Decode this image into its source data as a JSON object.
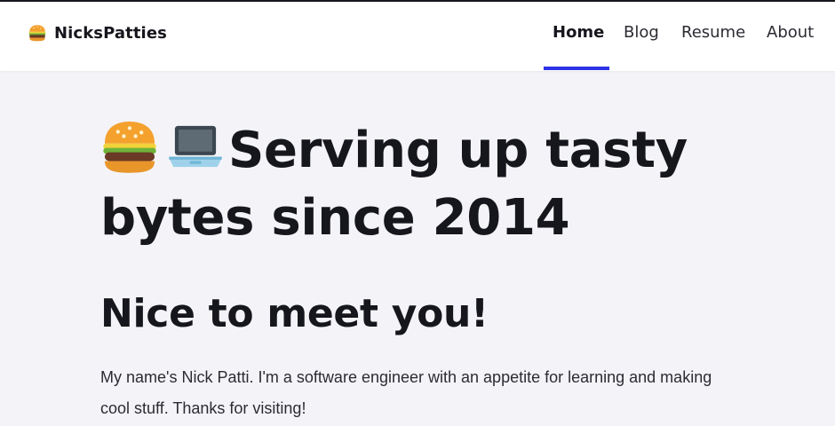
{
  "brand": {
    "name": "NicksPatties",
    "icon": "burger-icon"
  },
  "nav": {
    "items": [
      {
        "label": "Home",
        "active": true
      },
      {
        "label": "Blog",
        "active": false
      },
      {
        "label": "Resume",
        "active": false
      },
      {
        "label": "About",
        "active": false
      }
    ],
    "active_color": "#2d33e8"
  },
  "hero": {
    "icons": [
      "burger-icon",
      "laptop-icon"
    ],
    "title": "Serving up tasty bytes since 2014"
  },
  "section": {
    "title": "Nice to meet you!",
    "body": "My name's Nick Patti. I'm a software engineer with an appetite for learning and making cool stuff. Thanks for visiting!"
  },
  "colors": {
    "background": "#f4f4f8",
    "text": "#16161d",
    "navbar": "#ffffff"
  }
}
